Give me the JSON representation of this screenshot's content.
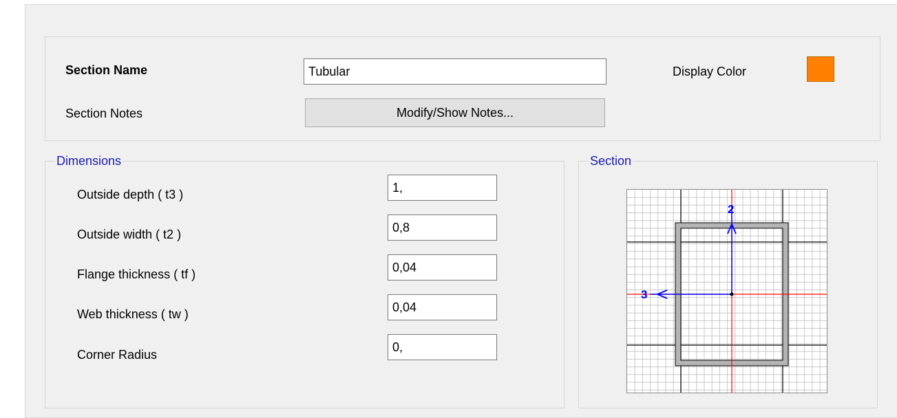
{
  "header": {
    "section_name_label": "Section Name",
    "section_name_value": "Tubular",
    "display_color_label": "Display Color",
    "display_color": "#ff8000",
    "section_notes_label": "Section Notes",
    "notes_button_label": "Modify/Show Notes..."
  },
  "dimensions": {
    "group_title": "Dimensions",
    "fields": [
      {
        "label": "Outside depth  ( t3 )",
        "value": "1,"
      },
      {
        "label": "Outside width  ( t2 )",
        "value": "0,8"
      },
      {
        "label": "Flange thickness  ( tf )",
        "value": "0,04"
      },
      {
        "label": "Web thickness  ( tw )",
        "value": "0,04"
      },
      {
        "label": "Corner Radius",
        "value": "0,"
      }
    ]
  },
  "section_preview": {
    "group_title": "Section",
    "axis_vertical_label": "2",
    "axis_horizontal_label": "3",
    "colors": {
      "axis_blue": "#0000ff",
      "center_red": "#ff0000",
      "grid_light": "#c8c8c8",
      "grid_major": "#000000",
      "section_fill": "#b4b4b4"
    }
  }
}
